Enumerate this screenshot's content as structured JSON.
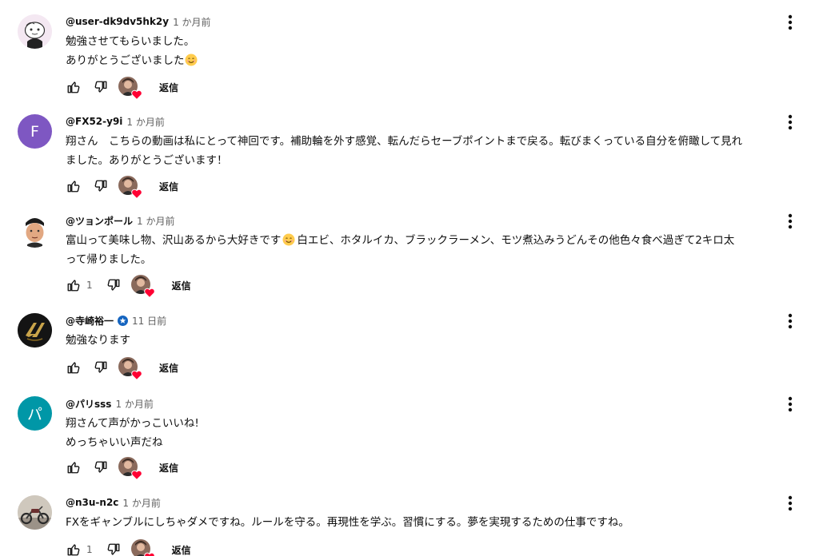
{
  "comments": [
    {
      "author": "@user-dk9dv5hk2y",
      "time": "1 か月前",
      "lines": [
        "勉強させてもらいました。",
        "ありがとうございました"
      ],
      "emoji_line": 1,
      "emoji": "smiling-face-emoji",
      "likes": "",
      "reply_label": "返信",
      "avatar": {
        "type": "illustration",
        "bg": "#f4e8f2",
        "icon": "cartoon-character-avatar"
      }
    },
    {
      "author": "@FX52-y9i",
      "time": "1 か月前",
      "lines": [
        "翔さん　こちらの動画は私にとって神回です。補助輪を外す感覚、転んだらセーブポイントまで戻る。転びまくっている自分を俯瞰して見れ",
        "ました。ありがとうございます！"
      ],
      "likes": "",
      "reply_label": "返信",
      "avatar": {
        "type": "letter",
        "letter": "F",
        "bg": "#7e57c2"
      }
    },
    {
      "author": "@ツョンポール",
      "time": "1 か月前",
      "lines": [
        "富山って美味し物、沢山あるから大好きです",
        "って帰りました。"
      ],
      "line0_after_emoji": "白エビ、ホタルイカ、ブラックラーメン、モツ煮込みうどんその他色々食べ過ぎて2キロ太",
      "likes": "1",
      "reply_label": "返信",
      "avatar": {
        "type": "photo",
        "bg": "#ffffff",
        "icon": "person-photo-avatar"
      }
    },
    {
      "author": "@寺崎裕一",
      "time": "11 日前",
      "verified": true,
      "lines": [
        "勉強なります"
      ],
      "likes": "",
      "reply_label": "返信",
      "avatar": {
        "type": "logo",
        "bg": "#1a1a1a",
        "icon": "gold-logo-avatar"
      }
    },
    {
      "author": "@パリsss",
      "time": "1 か月前",
      "lines": [
        "翔さんて声がかっこいいね!",
        "めっちゃいい声だね"
      ],
      "likes": "",
      "reply_label": "返信",
      "avatar": {
        "type": "letter",
        "letter": "パ",
        "bg": "#0097a7"
      }
    },
    {
      "author": "@n3u-n2c",
      "time": "1 か月前",
      "lines": [
        "FXをギャンブルにしちゃダメですね。ルールを守る。再現性を学ぶ。習慣にする。夢を実現するための仕事ですね。"
      ],
      "likes": "1",
      "reply_label": "返信",
      "avatar": {
        "type": "photo",
        "bg": "#c9c2b8",
        "icon": "motorcycle-photo-avatar"
      }
    }
  ],
  "colors": {
    "author": "#0f0f0f",
    "meta": "#606060",
    "heart": "#ff0033",
    "verified": "#1565c0"
  }
}
